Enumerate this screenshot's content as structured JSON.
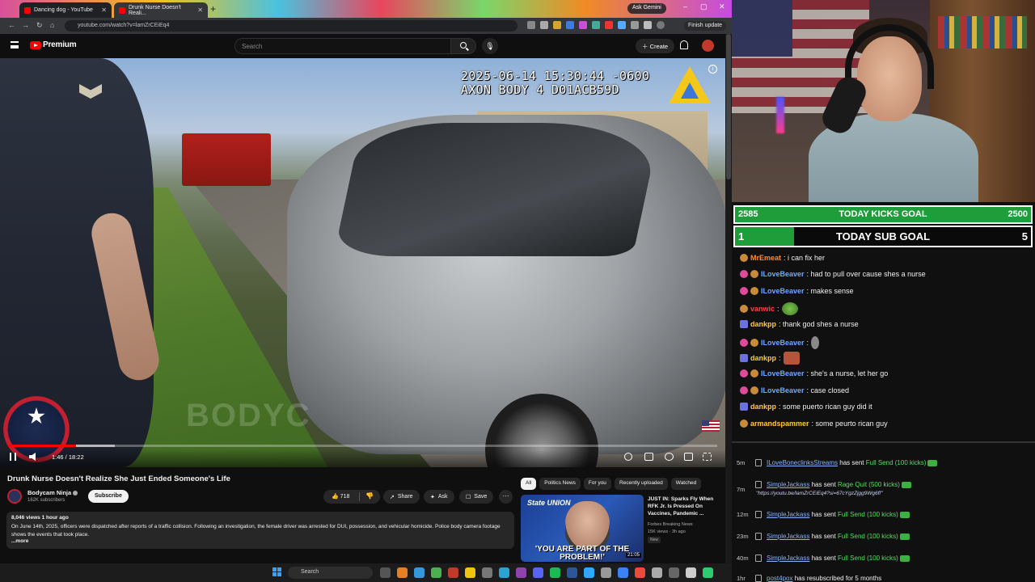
{
  "browser": {
    "tabs": [
      {
        "label": "Dancing dog - YouTube"
      },
      {
        "label": "Drunk Nurse Doesn't Reali..."
      }
    ],
    "ask_gemini": "Ask Gemini",
    "url": "youtube.com/watch?v=lamZrCEiEq4",
    "finish_update": "Finish update"
  },
  "youtube": {
    "logo_text": "Premium",
    "search_placeholder": "Search",
    "create_label": "Create"
  },
  "video": {
    "timestamp_line1": "2025-06-14 15:30:44 -0600",
    "timestamp_line2": "AXON BODY 4 D01ACB59D",
    "watermark": "BODYC",
    "current_time": "1:46 / 18:22",
    "progress_fraction": 0.096,
    "buffer_fraction": 0.15,
    "title": "Drunk Nurse Doesn't Realize She Just Ended Someone's Life"
  },
  "channel": {
    "name": "Bodycam Ninja",
    "subscribers": "162K subscribers",
    "subscribe_label": "Subscribe"
  },
  "actions": {
    "likes": "718",
    "share": "Share",
    "ask": "Ask",
    "save": "Save",
    "more": "···"
  },
  "description": {
    "meta": "8,046 views  1 hour ago",
    "text": "On June 14th, 2025, officers were dispatched after reports of a traffic collision.  Following an investigation, the female driver was arrested for DUI, possession, and vehicular homicide.  Police body camera footage shows the events that took place.",
    "more": "...more"
  },
  "chips": [
    "All",
    "Politics News",
    "For you",
    "Recently uploaded",
    "Watched"
  ],
  "recommendation": {
    "thumb_logo": "State UNION",
    "thumb_caption": "'YOU ARE PART OF THE PROBLEM!'",
    "duration": "21:05",
    "title": "JUST IN: Sparks Fly When RFK Jr. Is Pressed On Vaccines, Pandemic ...",
    "channel": "Forbes Breaking News",
    "views": "15K views · 3h ago",
    "badge": "New"
  },
  "taskbar": {
    "search": "Search"
  },
  "stream": {
    "kicks_goal": {
      "label": "TODAY KICKS GOAL",
      "current": "2585",
      "target": "2500",
      "fraction": 1.0
    },
    "sub_goal": {
      "label": "TODAY SUB GOAL",
      "current": "1",
      "target": "5",
      "fraction": 0.2
    },
    "chat": [
      {
        "user": "MrEmeat",
        "color": "#ff8c2a",
        "text": ": i can fix her"
      },
      {
        "user": "ILoveBeaver",
        "color": "#6fa8ff",
        "text": ": had to pull over cause shes a nurse"
      },
      {
        "user": "ILoveBeaver",
        "color": "#6fa8ff",
        "text": ": makes sense"
      },
      {
        "user": "vanwic",
        "color": "#ff4040",
        "text": ":"
      },
      {
        "user": "dankpp",
        "color": "#ffcc33",
        "text": ": thank god shes a nurse"
      },
      {
        "user": "ILoveBeaver",
        "color": "#6fa8ff",
        "text": ":"
      },
      {
        "user": "dankpp",
        "color": "#ffcc33",
        "text": ":"
      },
      {
        "user": "ILoveBeaver",
        "color": "#6fa8ff",
        "text": ": she's a nurse, let her go"
      },
      {
        "user": "ILoveBeaver",
        "color": "#6fa8ff",
        "text": ": case closed"
      },
      {
        "user": "dankpp",
        "color": "#ffcc33",
        "text": ": some puerto rican guy did it"
      },
      {
        "user": "armandspammer",
        "color": "#ffcc33",
        "text": ": some peurto rican guy"
      }
    ],
    "events": [
      {
        "time": "5m",
        "user": "ILoveBoneclinksStreams",
        "action": " has sent ",
        "gift": "Full Send (100 kicks)",
        "link": ""
      },
      {
        "time": "7m",
        "user": "SimpleJackass",
        "action": " has sent ",
        "gift": "Rage Quit (500 kicks)",
        "link": "\"https://youtu.be/lamZrCEiEq4?si=67cYgzZjgg9Wg6ff\""
      },
      {
        "time": "12m",
        "user": "SimpleJackass",
        "action": " has sent ",
        "gift": "Full Send (100 kicks)",
        "link": ""
      },
      {
        "time": "23m",
        "user": "SimpleJackass",
        "action": " has sent ",
        "gift": "Full Send (100 kicks)",
        "link": ""
      },
      {
        "time": "40m",
        "user": "SimpleJackass",
        "action": " has sent ",
        "gift": "Full Send (100 kicks)",
        "link": ""
      },
      {
        "time": "1hr",
        "user": "post4pox",
        "action": " has resubscribed for 5 months",
        "gift": "",
        "link": ""
      }
    ]
  }
}
